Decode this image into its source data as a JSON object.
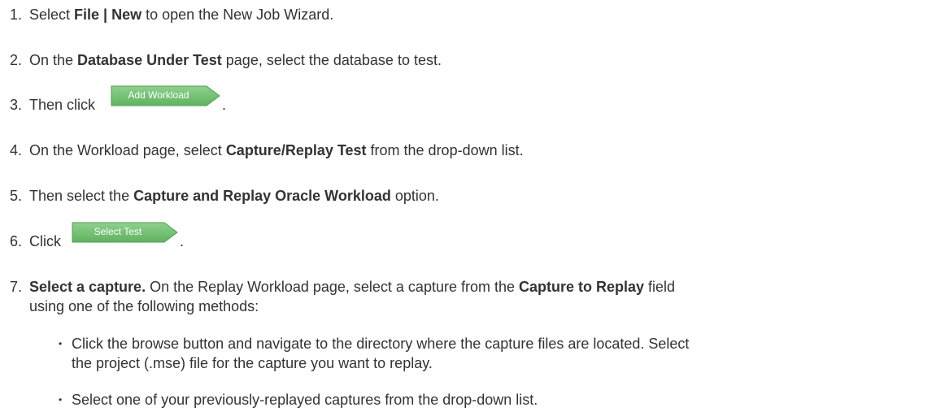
{
  "steps": [
    {
      "num": "1.",
      "pre": "Select ",
      "bold": "File | New",
      "post": " to open the New Job Wizard."
    },
    {
      "num": "2.",
      "pre": "On the ",
      "bold": "Database Under Test",
      "post": " page, select the database to test."
    },
    {
      "num": "3.",
      "pre": "Then click",
      "button": "Add Workload",
      "post": "."
    },
    {
      "num": "4.",
      "pre": "On the Workload page, select ",
      "bold": "Capture/Replay Test",
      "post": " from the drop-down list."
    },
    {
      "num": "5.",
      "pre": "Then select the ",
      "bold": "Capture and Replay Oracle Workload",
      "post": " option."
    },
    {
      "num": "6.",
      "pre": "Click",
      "button": "Select Test",
      "post": "."
    },
    {
      "num": "7.",
      "bold_lead": "Select a capture.",
      "pre": " On the Replay Workload page, select a capture from the ",
      "bold": "Capture to Replay",
      "post": " field",
      "line2": "using one of the following methods:"
    }
  ],
  "bullets": [
    {
      "line1": "Click the browse button and navigate to the directory where the capture files are located. Select",
      "line2": "the project (.mse) file for the capture you want to replay."
    },
    {
      "line1": "Select one of your previously-replayed captures from the drop-down list."
    }
  ],
  "colors": {
    "text": "#333333",
    "button_fill": "#6dbd6d",
    "button_fill_light": "#8fd08f",
    "button_border": "#4f9f4f"
  }
}
